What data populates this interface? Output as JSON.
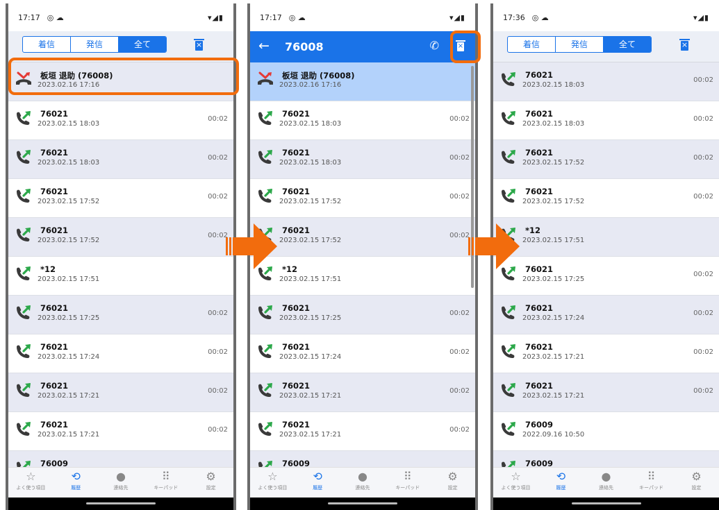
{
  "colors": {
    "accent": "#1a73e8",
    "highlight": "#f26c0d",
    "row_selected": "#b3d2fb",
    "row_shade": "#e7e9f3"
  },
  "status": {
    "times": [
      "17:17",
      "17:17",
      "17:36"
    ]
  },
  "tabs": [
    "着信",
    "発信",
    "全て"
  ],
  "tabs_active": "全て",
  "detail": {
    "title": "76008"
  },
  "panel1_rows": [
    {
      "name": "板垣 退助 (76008)",
      "date": "2023.02.16 17:16",
      "dur": "",
      "icon": "missed-call-icon"
    },
    {
      "name": "76021",
      "date": "2023.02.15 18:03",
      "dur": "00:02",
      "icon": "outgoing-call-icon"
    },
    {
      "name": "76021",
      "date": "2023.02.15 18:03",
      "dur": "00:02",
      "icon": "outgoing-call-icon"
    },
    {
      "name": "76021",
      "date": "2023.02.15 17:52",
      "dur": "00:02",
      "icon": "outgoing-call-icon"
    },
    {
      "name": "76021",
      "date": "2023.02.15 17:52",
      "dur": "00:02",
      "icon": "outgoing-call-icon"
    },
    {
      "name": "*12",
      "date": "2023.02.15 17:51",
      "dur": "",
      "icon": "outgoing-call-icon"
    },
    {
      "name": "76021",
      "date": "2023.02.15 17:25",
      "dur": "00:02",
      "icon": "outgoing-call-icon"
    },
    {
      "name": "76021",
      "date": "2023.02.15 17:24",
      "dur": "00:02",
      "icon": "outgoing-call-icon"
    },
    {
      "name": "76021",
      "date": "2023.02.15 17:21",
      "dur": "00:02",
      "icon": "outgoing-call-icon"
    },
    {
      "name": "76021",
      "date": "2023.02.15 17:21",
      "dur": "00:02",
      "icon": "outgoing-call-icon"
    },
    {
      "name": "76009",
      "date": "",
      "dur": "",
      "icon": "outgoing-call-icon"
    }
  ],
  "panel3_rows": [
    {
      "name": "76021",
      "date": "2023.02.15 18:03",
      "dur": "00:02",
      "icon": "outgoing-call-icon"
    },
    {
      "name": "76021",
      "date": "2023.02.15 18:03",
      "dur": "00:02",
      "icon": "outgoing-call-icon"
    },
    {
      "name": "76021",
      "date": "2023.02.15 17:52",
      "dur": "00:02",
      "icon": "outgoing-call-icon"
    },
    {
      "name": "76021",
      "date": "2023.02.15 17:52",
      "dur": "00:02",
      "icon": "outgoing-call-icon"
    },
    {
      "name": "*12",
      "date": "2023.02.15 17:51",
      "dur": "",
      "icon": "outgoing-call-icon"
    },
    {
      "name": "76021",
      "date": "2023.02.15 17:25",
      "dur": "00:02",
      "icon": "outgoing-call-icon"
    },
    {
      "name": "76021",
      "date": "2023.02.15 17:24",
      "dur": "00:02",
      "icon": "outgoing-call-icon"
    },
    {
      "name": "76021",
      "date": "2023.02.15 17:21",
      "dur": "00:02",
      "icon": "outgoing-call-icon"
    },
    {
      "name": "76021",
      "date": "2023.02.15 17:21",
      "dur": "00:02",
      "icon": "outgoing-call-icon"
    },
    {
      "name": "76009",
      "date": "2022.09.16 10:50",
      "dur": "",
      "icon": "outgoing-call-icon"
    },
    {
      "name": "76009",
      "date": "",
      "dur": "",
      "icon": "outgoing-call-icon"
    }
  ],
  "nav": [
    {
      "label": "よく使う項目",
      "icon": "star-icon",
      "active": false
    },
    {
      "label": "履歴",
      "icon": "history-icon",
      "active": true
    },
    {
      "label": "連絡先",
      "icon": "person-icon",
      "active": false
    },
    {
      "label": "キーパッド",
      "icon": "keypad-icon",
      "active": false
    },
    {
      "label": "設定",
      "icon": "gear-icon",
      "active": false
    }
  ]
}
